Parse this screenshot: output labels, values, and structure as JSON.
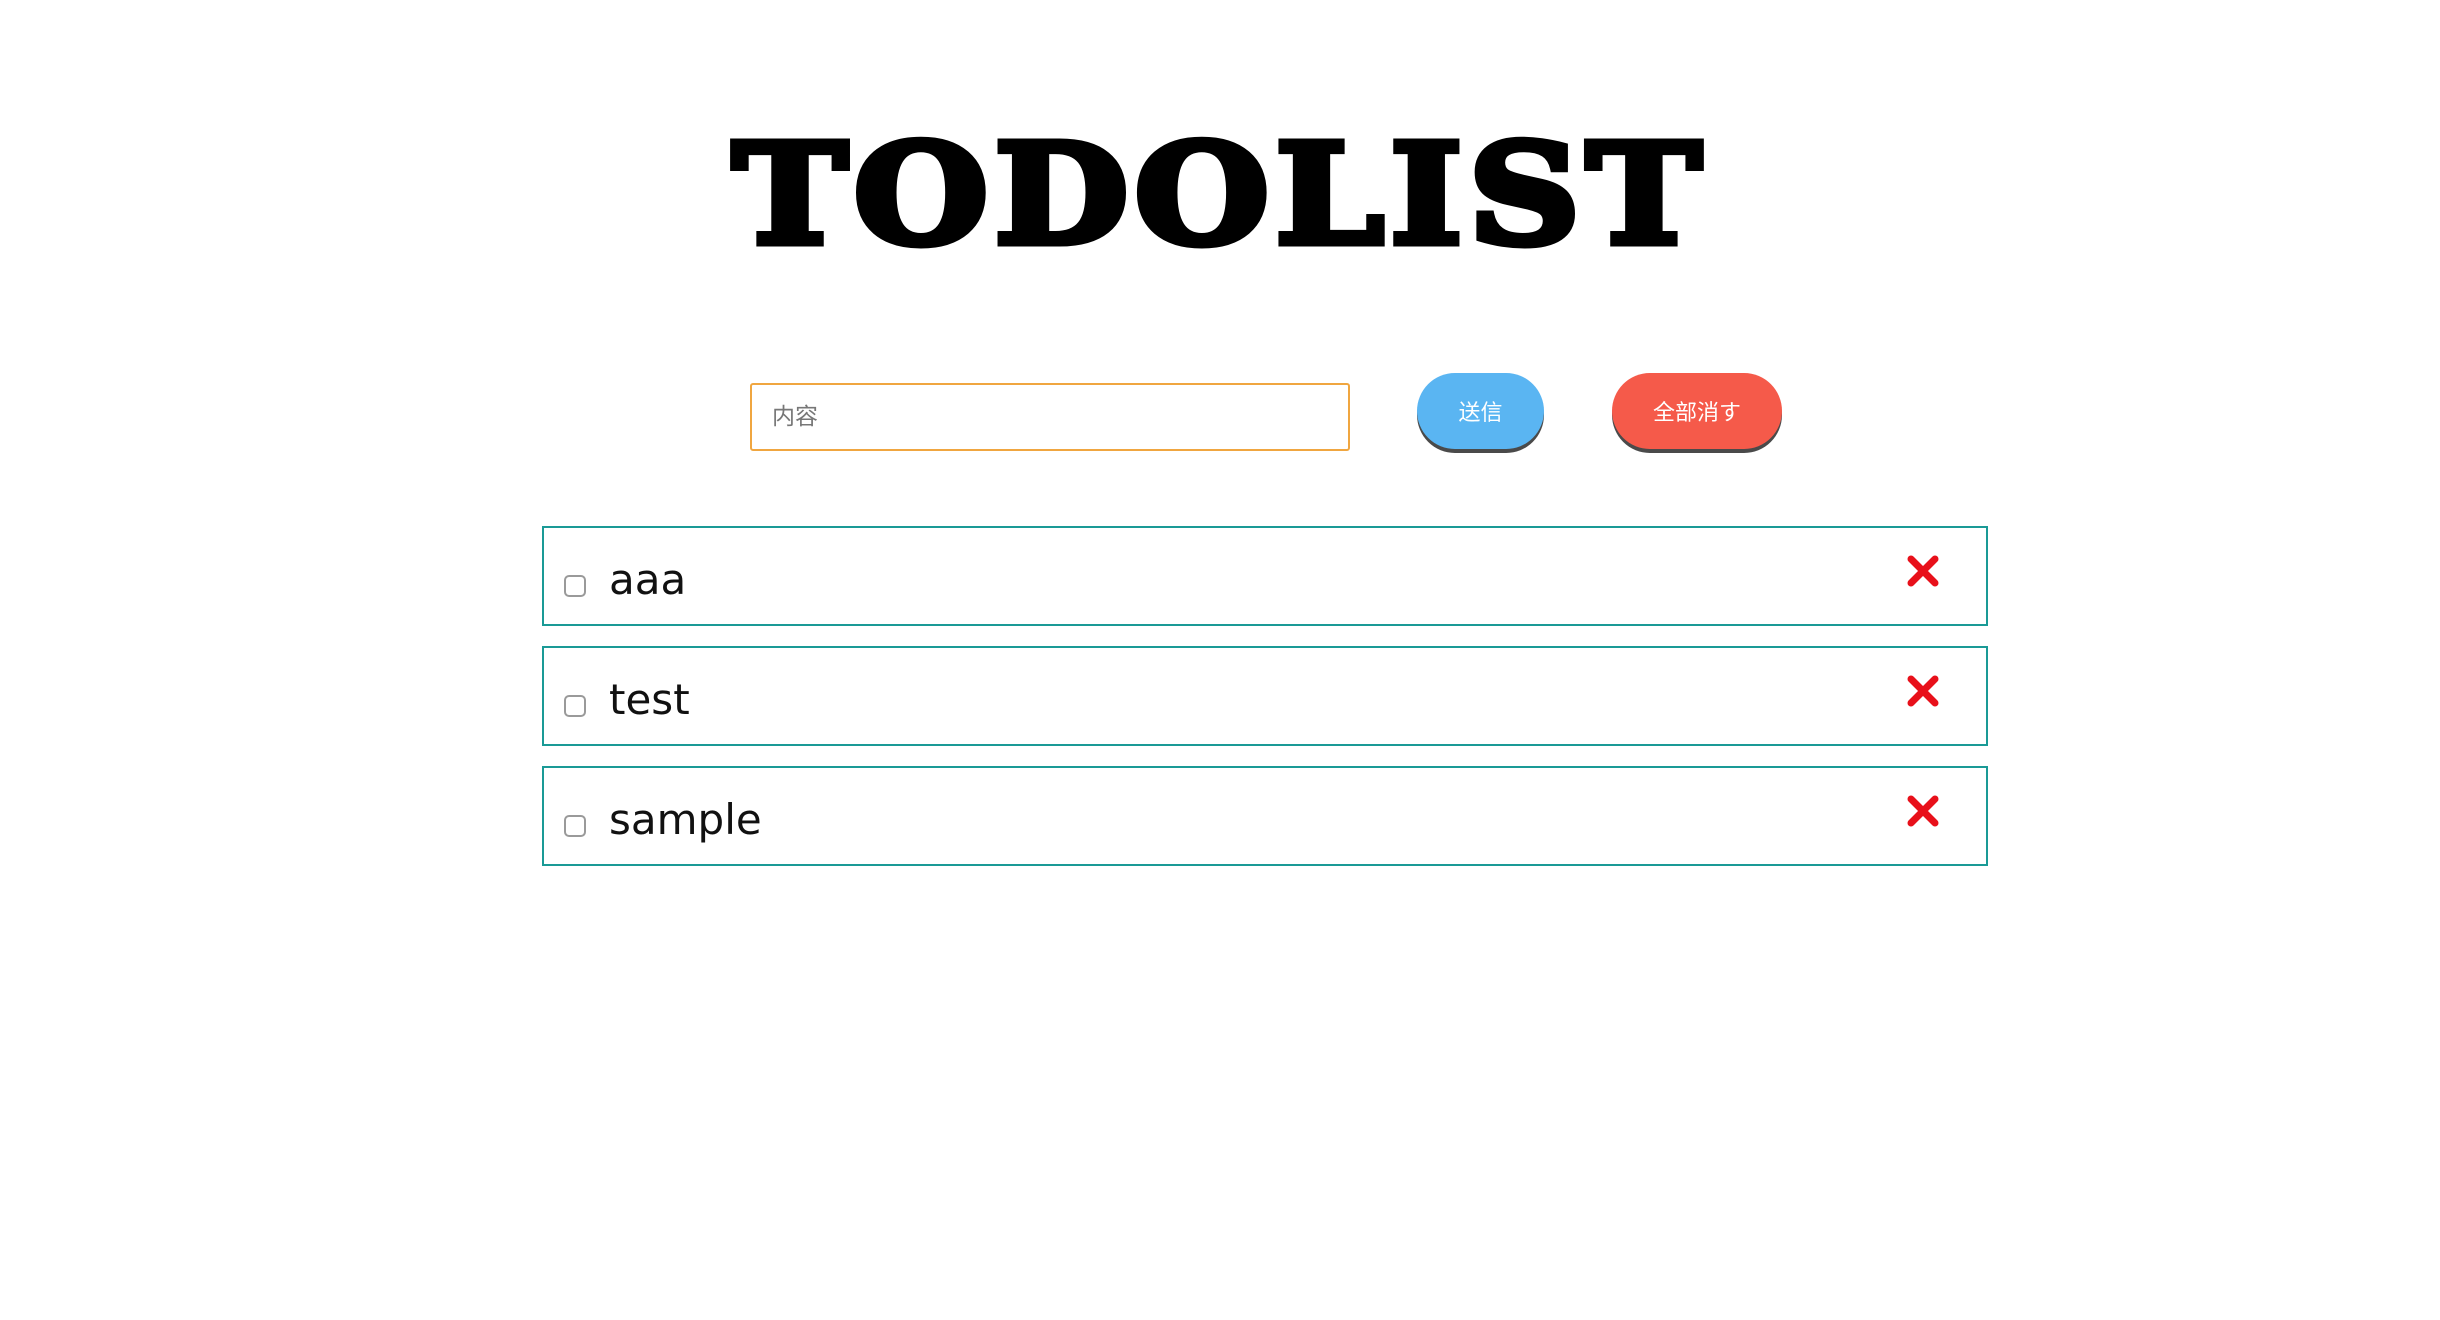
{
  "title": "TODOLIST",
  "form": {
    "input_placeholder": "内容",
    "input_value": "",
    "send_label": "送信",
    "clear_all_label": "全部消す"
  },
  "todos": [
    {
      "text": "aaa",
      "checked": false
    },
    {
      "text": "test",
      "checked": false
    },
    {
      "text": "sample",
      "checked": false
    }
  ],
  "icons": {
    "delete": "close-icon"
  },
  "colors": {
    "send_button": "#5ab5f2",
    "clear_button": "#f55a4a",
    "input_border": "#f0a640",
    "item_border": "#1a9a96",
    "delete_icon": "#e8101a"
  }
}
